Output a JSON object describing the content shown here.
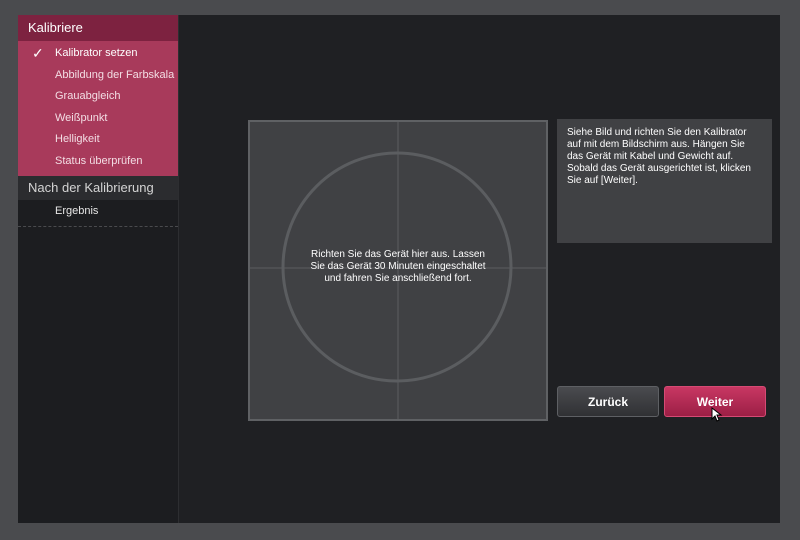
{
  "sidebar": {
    "section1": {
      "title": "Kalibriere",
      "items": [
        {
          "label": "Kalibrator setzen",
          "checked": true
        },
        {
          "label": "Abbildung der Farbskala"
        },
        {
          "label": "Grauabgleich"
        },
        {
          "label": "Weißpunkt"
        },
        {
          "label": "Helligkeit"
        },
        {
          "label": "Status überprüfen"
        }
      ]
    },
    "section2": {
      "title": "Nach der Kalibrierung",
      "items": [
        {
          "label": "Ergebnis"
        }
      ]
    }
  },
  "target": {
    "text": "Richten Sie das Gerät hier aus. Lassen Sie das Gerät 30 Minuten eingeschaltet und fahren Sie anschließend fort."
  },
  "info": {
    "text": "Siehe Bild und richten Sie den Kalibrator auf mit dem Bildschirm aus. Hängen Sie das Gerät mit Kabel und Gewicht auf. Sobald das Gerät ausgerichtet ist, klicken Sie auf [Weiter]."
  },
  "buttons": {
    "back": "Zurück",
    "next": "Weiter"
  },
  "colors": {
    "accent": "#a83a5b",
    "accent_dark": "#7d2240",
    "button_next": "#b82a55",
    "background": "#1f2023"
  },
  "icons": {
    "check": "check-icon",
    "cursor": "mouse-cursor-icon"
  }
}
